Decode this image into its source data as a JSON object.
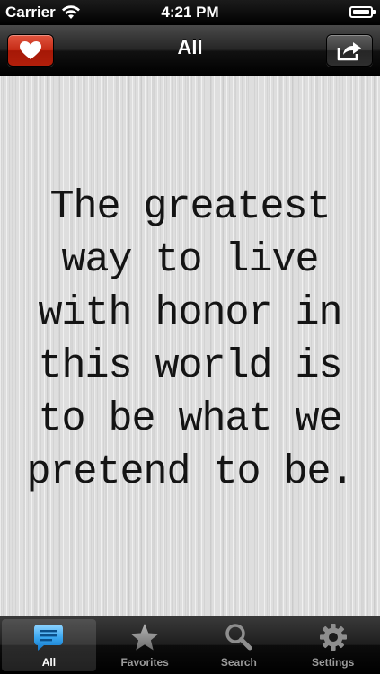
{
  "status_bar": {
    "carrier": "Carrier",
    "time": "4:21 PM",
    "icons": [
      "wifi-icon",
      "battery-icon"
    ]
  },
  "nav_bar": {
    "title": "All",
    "left_button_icon": "heart-icon",
    "right_button_icon": "share-icon"
  },
  "quote": {
    "text": "The greatest way to live with honor in this world is to be what we pretend to be."
  },
  "tab_bar": {
    "tabs": [
      {
        "label": "All",
        "icon": "speech-bubble-icon",
        "active": true
      },
      {
        "label": "Favorites",
        "icon": "star-icon",
        "active": false
      },
      {
        "label": "Search",
        "icon": "magnifier-icon",
        "active": false
      },
      {
        "label": "Settings",
        "icon": "gear-icon",
        "active": false
      }
    ]
  },
  "colors": {
    "favorite_button": "#c52a15",
    "active_tab_icon": "#3aa7f0",
    "inactive_tab_icon": "#8e8e8e",
    "quote_text": "#141414"
  }
}
